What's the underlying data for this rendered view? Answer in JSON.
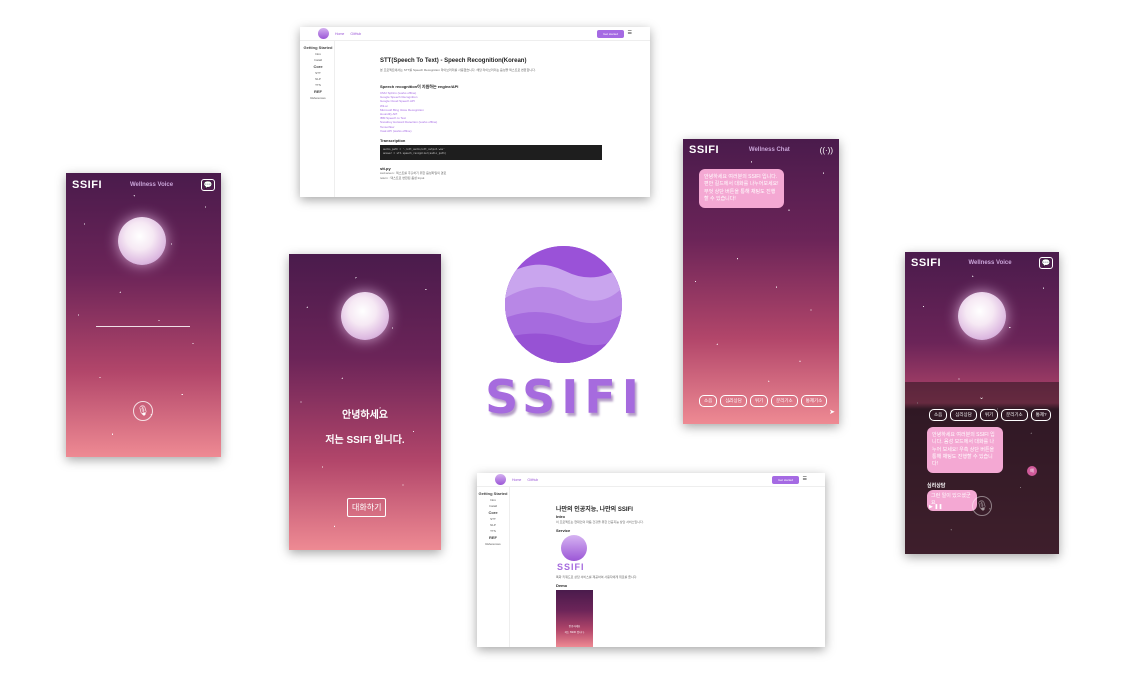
{
  "brand": "SSIFI",
  "voice_screen": {
    "subtitle": "Wellness Voice",
    "icon": "chat-icon",
    "mic": "mic-icon"
  },
  "intro_screen": {
    "greeting_line1": "안녕하세요",
    "greeting_line2": "저는 SSIFI 입니다.",
    "button": "대화하기"
  },
  "chat_screen": {
    "subtitle": "Wellness Chat",
    "bubble": "안녕하세요 여러분의 SSIFI 입니다. 편안 길드에서 대화를 나누어보세요! 무엇 상단 버튼을 통해 채팅도 진행할 수 있습니다!",
    "chips": [
      "소음",
      "심리상담",
      "위기",
      "분리기소",
      "통제기소"
    ]
  },
  "voice_chat_screen": {
    "subtitle": "Wellness Voice",
    "chips": [
      "소음",
      "심리상담",
      "위기",
      "분리기소",
      "통제?"
    ],
    "bubble": "안녕하세요 여러분의 SSIFI 입니다. 음성 모드에서 대화를 나누어 보세요! 우측 상단 버튼을 통해 채팅도 진행할 수 있습니다!",
    "section_label": "심리상담",
    "user_bubble": "그런 일이 있으셨군요",
    "badge": "예"
  },
  "doc_top": {
    "nav": [
      "Home",
      "GitHub"
    ],
    "launch": "Get started",
    "sidebar": {
      "section": "Getting Started",
      "items": [
        "Intro",
        "Install"
      ],
      "core": "Core",
      "core_items": [
        "STT",
        "NLP",
        "TTS"
      ],
      "ref": "REF",
      "ref_items": [
        "References"
      ]
    },
    "title": "STT(Speech To Text) - Speech Recognition(Korean)",
    "intro": "본 프로젝트에서는 STT를 Speech Recognition 라이브러리를 사용했습니다. 해당 라이브러리는 음성을 텍스트로 변환합니다.",
    "engines_title": "Speech recognition이 지원하는 engine/API",
    "engines": [
      "CMU Sphinx (works offline)",
      "Google Speech Recognition",
      "Google Cloud Speech API",
      "Wit.ai",
      "Microsoft Bing Voice Recognition",
      "Houndify API",
      "IBM Speech to Text",
      "Snowboy Hotword Detection (works offline)",
      "Tensorflow",
      "Vosk API (works offline)"
    ],
    "transcription": "Transcription",
    "code": [
      "audio_path = './stt_audio/stt_output.wav'",
      "answer = stt.speech_recognizer(audio_path)"
    ],
    "file": "stt.py",
    "file_desc": [
      "ssd.seven : 텍스트를 추출하기 위한 음성파일의 경로",
      "return : 텍스트로 변환된 음성 Input"
    ]
  },
  "doc_bottom": {
    "nav": [
      "Home",
      "GitHub"
    ],
    "launch": "Get started",
    "sidebar": {
      "section": "Getting Started",
      "items": [
        "Intro",
        "Install"
      ],
      "core": "Core",
      "core_items": [
        "STT",
        "NLP",
        "TTS"
      ],
      "ref": "REF",
      "ref_items": [
        "References"
      ]
    },
    "title": "나만의 인공지능, 나만의 SSIFI",
    "intro_h": "Intro",
    "intro_p": "이 프로젝트는 현대인의 마음 건강을 위한 인공지능 상담 서비스입니다.",
    "service_h": "Service",
    "service_caption": "특화 키워드로 상담 서비스를 제공하여 사용자에게 위로를 줍니다.",
    "demo_h": "Demo",
    "demo_line1": "안녕하세요",
    "demo_line2": "저는 SSIFI 입니다."
  },
  "center_logo": {
    "text": "SSIFI"
  },
  "colors": {
    "accent": "#a56ae3",
    "night_top": "#4a1b4c",
    "dusk_bottom": "#ee8a93"
  }
}
